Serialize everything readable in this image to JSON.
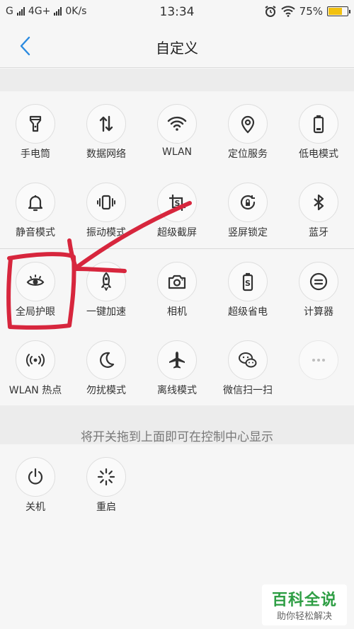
{
  "statusbar": {
    "carrier": "G",
    "network": "4G+",
    "speed": "0K/s",
    "time": "13:34",
    "battery": "75%",
    "battery_level": 0.75,
    "battery_color": "#f2c10f"
  },
  "header": {
    "title": "自定义",
    "back_icon": "chevron-left-icon",
    "back_color": "#2a8ae0"
  },
  "active_tiles": [
    {
      "label": "手电筒",
      "icon": "flashlight-icon"
    },
    {
      "label": "数据网络",
      "icon": "data-arrows-icon"
    },
    {
      "label": "WLAN",
      "icon": "wifi-icon"
    },
    {
      "label": "定位服务",
      "icon": "location-pin-icon"
    },
    {
      "label": "低电模式",
      "icon": "battery-icon"
    },
    {
      "label": "静音模式",
      "icon": "bell-icon"
    },
    {
      "label": "振动模式",
      "icon": "vibrate-icon"
    },
    {
      "label": "超级截屏",
      "icon": "crop-s-icon"
    },
    {
      "label": "竖屏锁定",
      "icon": "rotation-lock-icon"
    },
    {
      "label": "蓝牙",
      "icon": "bluetooth-icon"
    }
  ],
  "available_tiles": [
    {
      "label": "全局护眼",
      "icon": "eye-icon"
    },
    {
      "label": "一键加速",
      "icon": "rocket-icon"
    },
    {
      "label": "相机",
      "icon": "camera-icon"
    },
    {
      "label": "超级省电",
      "icon": "battery-s-icon"
    },
    {
      "label": "计算器",
      "icon": "calculator-icon"
    },
    {
      "label": "WLAN 热点",
      "icon": "hotspot-icon"
    },
    {
      "label": "勿扰模式",
      "icon": "moon-icon"
    },
    {
      "label": "离线模式",
      "icon": "airplane-icon"
    },
    {
      "label": "微信扫一扫",
      "icon": "wechat-icon"
    },
    {
      "label": "",
      "icon": "more-dots-icon"
    }
  ],
  "hint": "将开关拖到上面即可在控制中心显示",
  "power_tiles": [
    {
      "label": "关机",
      "icon": "power-icon"
    },
    {
      "label": "重启",
      "icon": "restart-icon"
    }
  ],
  "watermark": {
    "title": "百科全说",
    "subtitle": "助你轻松解决"
  },
  "annotation_color": "#d7263d"
}
